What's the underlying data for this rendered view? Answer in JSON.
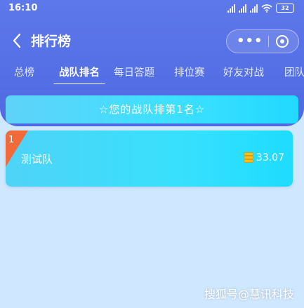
{
  "status_bar": {
    "time": "16:10",
    "battery": "32"
  },
  "nav": {
    "back_icon": "chevron-left",
    "title": "排行榜",
    "more_icon": "•••",
    "close_icon": "target-circle"
  },
  "tabs": [
    {
      "label": "总榜",
      "active": false
    },
    {
      "label": "战队排名",
      "active": true
    },
    {
      "label": "每日答题",
      "active": false
    },
    {
      "label": "排位赛",
      "active": false
    },
    {
      "label": "好友对战",
      "active": false
    },
    {
      "label": "团队",
      "active": false
    }
  ],
  "banner": {
    "text": "☆您的战队排第1名☆"
  },
  "ranking": [
    {
      "rank": "1",
      "team": "测试队",
      "score": "33.07"
    }
  ],
  "watermark": "搜狐号@慧讯科技",
  "colors": {
    "header": "#5d78ea",
    "background": "#cfe7ff",
    "card": "#3fe0ff",
    "rank_corner": "#f36a3a",
    "coin": "#f5c21b"
  }
}
